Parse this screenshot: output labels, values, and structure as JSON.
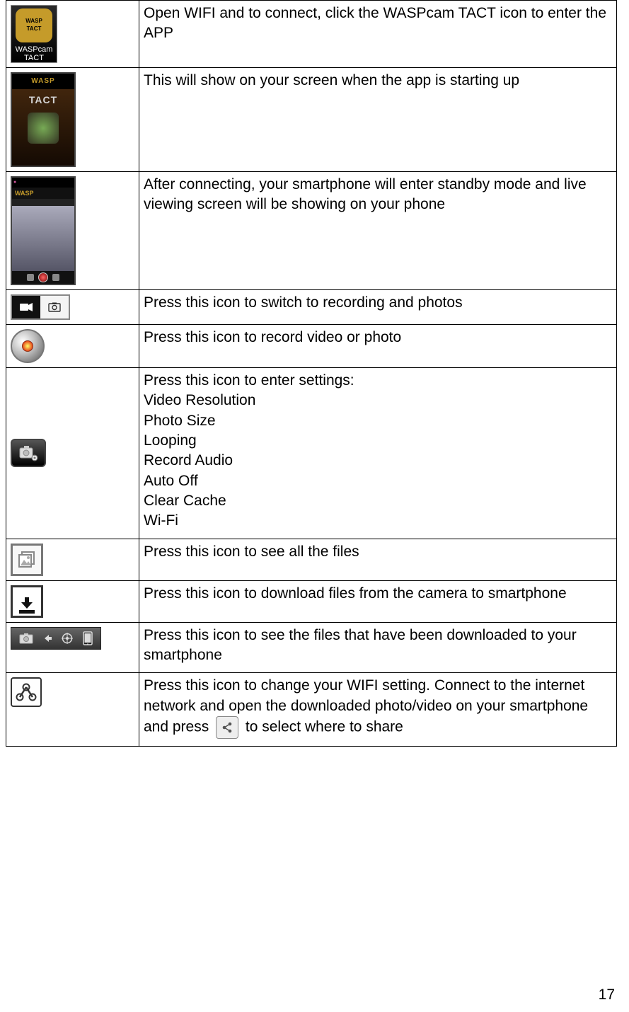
{
  "page_number": "17",
  "app_icon_label": "WASPcam\nTACT",
  "app_icon_badge": "WASP\nTACT",
  "rows": [
    {
      "text": "Open WIFI and to connect, click the WASPcam TACT icon to enter the APP"
    },
    {
      "text": "This will show on your screen when the app is starting up"
    },
    {
      "text": "After connecting, your smartphone will enter standby mode and live viewing screen will be showing on your phone"
    },
    {
      "text": "Press this icon to switch to recording and photos"
    },
    {
      "text": "Press this icon to record video or photo"
    },
    {
      "lead": "Press this icon to enter settings:",
      "items": [
        "Video Resolution",
        "Photo Size",
        "Looping",
        "Record Audio",
        "Auto Off",
        "Clear Cache",
        "Wi-Fi"
      ]
    },
    {
      "text": "Press this icon to see all the files"
    },
    {
      "text": "Press this icon to download files from the camera to smartphone"
    },
    {
      "text": "Press this icon to see the files that have been downloaded to your smartphone"
    },
    {
      "pre": "Press this icon to change your WIFI setting. Connect to the internet network and open the downloaded photo/video on your smartphone and press ",
      "post": " to select where to share"
    }
  ],
  "splash_logo": "WASP",
  "splash_word": "TACT",
  "live_logo": "WASP"
}
